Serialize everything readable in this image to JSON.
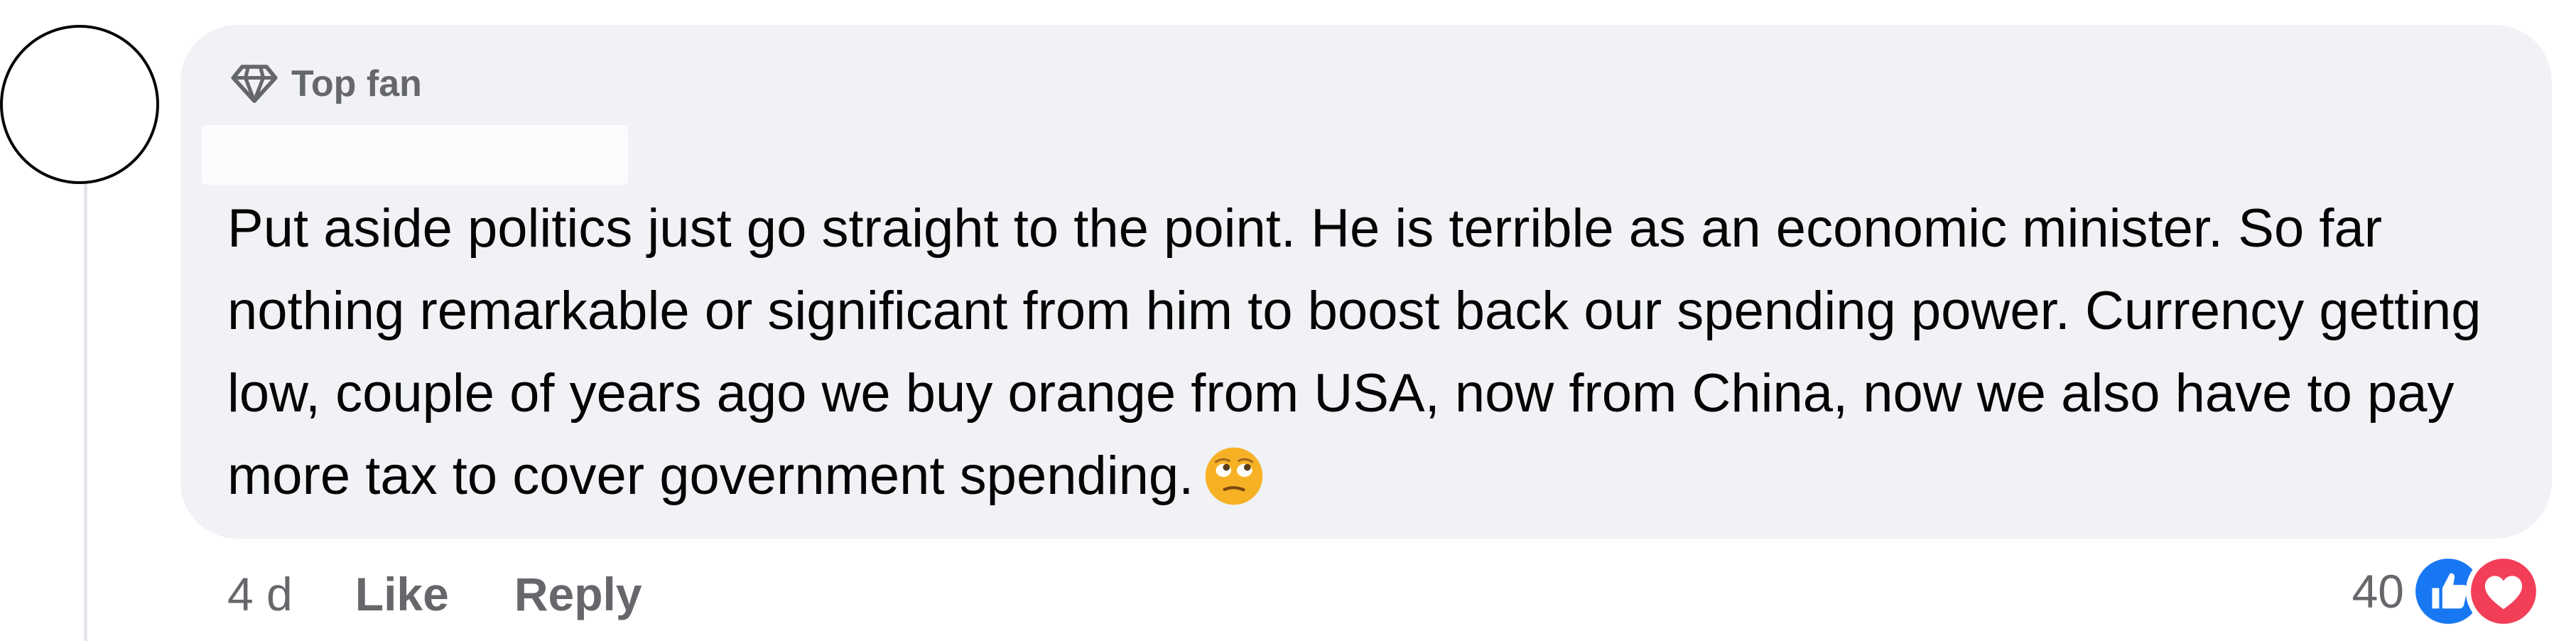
{
  "comment": {
    "badge": {
      "label": "Top fan",
      "icon": "diamond-icon"
    },
    "author_name": "",
    "text": "Put aside politics just go straight to the point. He is terrible as an economic minister. So far nothing remarkable or significant from him to boost back our spending power. Currency getting low, couple of years ago we buy orange from USA, now from China, now we also have to pay more tax to cover government spending.",
    "emoji": "rolling-eyes-emoji",
    "timestamp": "4 d",
    "actions": {
      "like_label": "Like",
      "reply_label": "Reply"
    },
    "reactions": {
      "count": "40",
      "types": [
        "like-reaction-icon",
        "love-reaction-icon"
      ]
    }
  },
  "colors": {
    "bubble_background": "#f0f2f5",
    "text_primary": "#050505",
    "text_secondary": "#65676b",
    "like_blue": "#1877f2",
    "love_red": "#f33e58",
    "emoji_yellow": "#f7b125"
  }
}
